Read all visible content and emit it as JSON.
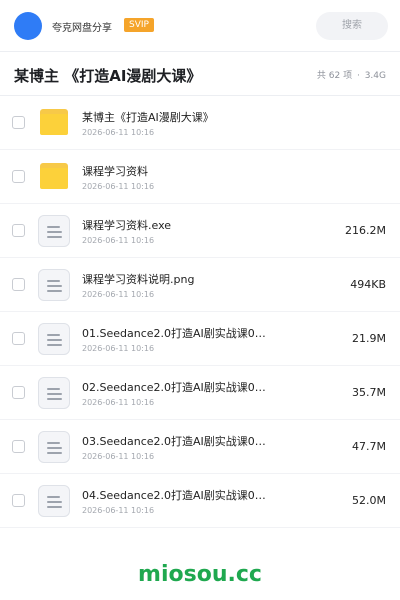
{
  "header": {
    "user_name": "夸克网盘分享",
    "badge": "SVIP",
    "search_label": "搜索"
  },
  "titlebar": {
    "title": "某博主 《打造AI漫剧大课》",
    "count": "共 62 项",
    "separator": "·",
    "total_size": "3.4G"
  },
  "files": [
    {
      "type": "folder",
      "icon": "folder-icon",
      "name": "某博主《打造AI漫剧大课》",
      "date": "2026-06-11 10:16",
      "size": ""
    },
    {
      "type": "folder",
      "icon": "folder-icon",
      "name": "课程学习资料",
      "date": "2026-06-11 10:16",
      "size": ""
    },
    {
      "type": "file",
      "icon": "document-icon",
      "name": "课程学习资料.exe",
      "date": "2026-06-11 10:16",
      "size": "216.2M"
    },
    {
      "type": "file",
      "icon": "document-icon",
      "name": "课程学习资料说明.png",
      "date": "2026-06-11 10:16",
      "size": "494KB"
    },
    {
      "type": "file",
      "icon": "document-icon",
      "name": "01.Seedance2.0打造AI剧实战课01.…",
      "date": "2026-06-11 10:16",
      "size": "21.9M"
    },
    {
      "type": "file",
      "icon": "document-icon",
      "name": "02.Seedance2.0打造AI剧实战课02.…",
      "date": "2026-06-11 10:16",
      "size": "35.7M"
    },
    {
      "type": "file",
      "icon": "document-icon",
      "name": "03.Seedance2.0打造AI剧实战课03.…",
      "date": "2026-06-11 10:16",
      "size": "47.7M"
    },
    {
      "type": "file",
      "icon": "document-icon",
      "name": "04.Seedance2.0打造AI剧实战课04.…",
      "date": "2026-06-11 10:16",
      "size": "52.0M"
    }
  ],
  "watermark": "miosou.cc",
  "colors": {
    "avatar": "#2f7cf6",
    "svip_badge": "#f5a42a",
    "folder": "#fcd13a",
    "watermark": "#1fa84f"
  }
}
